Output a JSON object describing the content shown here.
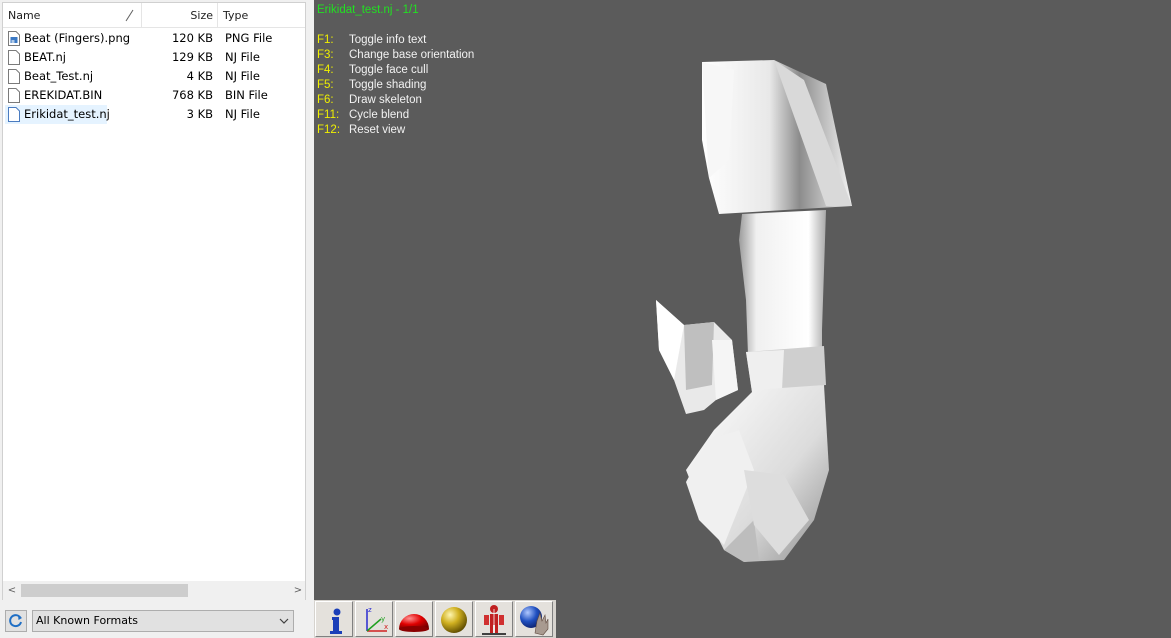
{
  "file_list": {
    "columns": {
      "name": "Name",
      "size": "Size",
      "type": "Type"
    },
    "rows": [
      {
        "name": "Beat (Fingers).png",
        "size": "120 KB",
        "type": "PNG File",
        "icon": "image-file-icon"
      },
      {
        "name": "BEAT.nj",
        "size": "129 KB",
        "type": "NJ File",
        "icon": "file-icon"
      },
      {
        "name": "Beat_Test.nj",
        "size": "4 KB",
        "type": "NJ File",
        "icon": "file-icon"
      },
      {
        "name": "EREKIDAT.BIN",
        "size": "768 KB",
        "type": "BIN File",
        "icon": "file-icon"
      },
      {
        "name": "Erikidat_test.nj",
        "size": "3 KB",
        "type": "NJ File",
        "icon": "file-icon",
        "selected": true
      }
    ],
    "scroll_left_arrow": "<",
    "scroll_right_arrow": ">"
  },
  "format_filter": {
    "selected": "All Known Formats"
  },
  "viewport": {
    "title": "Erikidat_test.nj - 1/1",
    "title_color": "#22e022",
    "key_color": "#f0f000",
    "background": "#5b5b5b",
    "help": [
      {
        "key": "F1:",
        "action": "Toggle info text"
      },
      {
        "key": "F3:",
        "action": "Change base orientation"
      },
      {
        "key": "F4:",
        "action": "Toggle face cull"
      },
      {
        "key": "F5:",
        "action": "Toggle shading"
      },
      {
        "key": "F6:",
        "action": "Draw skeleton"
      },
      {
        "key": "F11:",
        "action": "Cycle blend"
      },
      {
        "key": "F12:",
        "action": "Reset view"
      }
    ]
  },
  "toolbar": {
    "buttons": [
      {
        "name": "info-button",
        "icon": "info-icon"
      },
      {
        "name": "axes-button",
        "icon": "axes-icon"
      },
      {
        "name": "face-cull-button",
        "icon": "red-hemisphere-icon"
      },
      {
        "name": "shading-button",
        "icon": "gold-sphere-icon"
      },
      {
        "name": "skeleton-button",
        "icon": "skeleton-figure-icon"
      },
      {
        "name": "blend-button",
        "icon": "blend-hand-icon"
      }
    ]
  }
}
